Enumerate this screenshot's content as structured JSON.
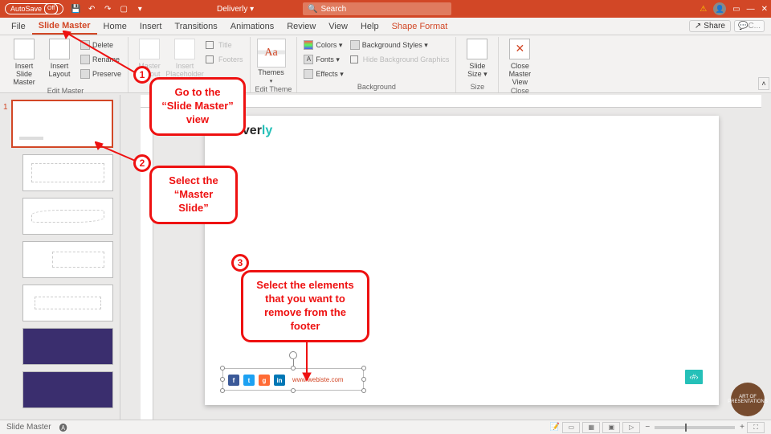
{
  "titlebar": {
    "autosave_label": "AutoSave",
    "autosave_state": "Off",
    "doc_name": "Deliverly ▾",
    "search_placeholder": "Search"
  },
  "tabs": {
    "file": "File",
    "slide_master": "Slide Master",
    "home": "Home",
    "insert": "Insert",
    "transitions": "Transitions",
    "animations": "Animations",
    "review": "Review",
    "view": "View",
    "help": "Help",
    "shape_format": "Shape Format",
    "share": "Share",
    "comments": "C..."
  },
  "ribbon": {
    "edit_master": {
      "label": "Edit Master",
      "insert_slide_master": "Insert Slide\nMaster",
      "insert_layout": "Insert\nLayout",
      "delete": "Delete",
      "rename": "Rename",
      "preserve": "Preserve"
    },
    "master_layout": {
      "label": "Master Layout",
      "master_layout": "Master\nLayout",
      "insert_placeholder": "Insert\nPlaceholder",
      "title": "Title",
      "footers": "Footers"
    },
    "edit_theme": {
      "label": "Edit Theme",
      "themes": "Themes"
    },
    "background": {
      "label": "Background",
      "colors": "Colors ▾",
      "fonts": "Fonts ▾",
      "effects": "Effects ▾",
      "bg_styles": "Background Styles ▾",
      "hide_bg": "Hide Background Graphics"
    },
    "size": {
      "label": "Size",
      "slide_size": "Slide\nSize ▾"
    },
    "close": {
      "label": "Close",
      "close_master": "Close\nMaster View"
    }
  },
  "sidepane": {
    "master_index": "1"
  },
  "slide": {
    "brand_a": "liver",
    "brand_b": "ly",
    "footer_url": "www.webiste.com",
    "slide_num": "‹#›"
  },
  "callouts": {
    "step1_num": "1",
    "step1_text": "Go to the\n“Slide Master”\nview",
    "step2_num": "2",
    "step2_text": "Select the\n“Master Slide”",
    "step3_num": "3",
    "step3_text": "Select the elements\nthat you want to\nremove from the\nfooter"
  },
  "statusbar": {
    "mode": "Slide Master",
    "zoom_pct": "- –––––|––––– +",
    "fit": "⛶"
  },
  "watermark": "ART OF\nPRESENTATIONS"
}
